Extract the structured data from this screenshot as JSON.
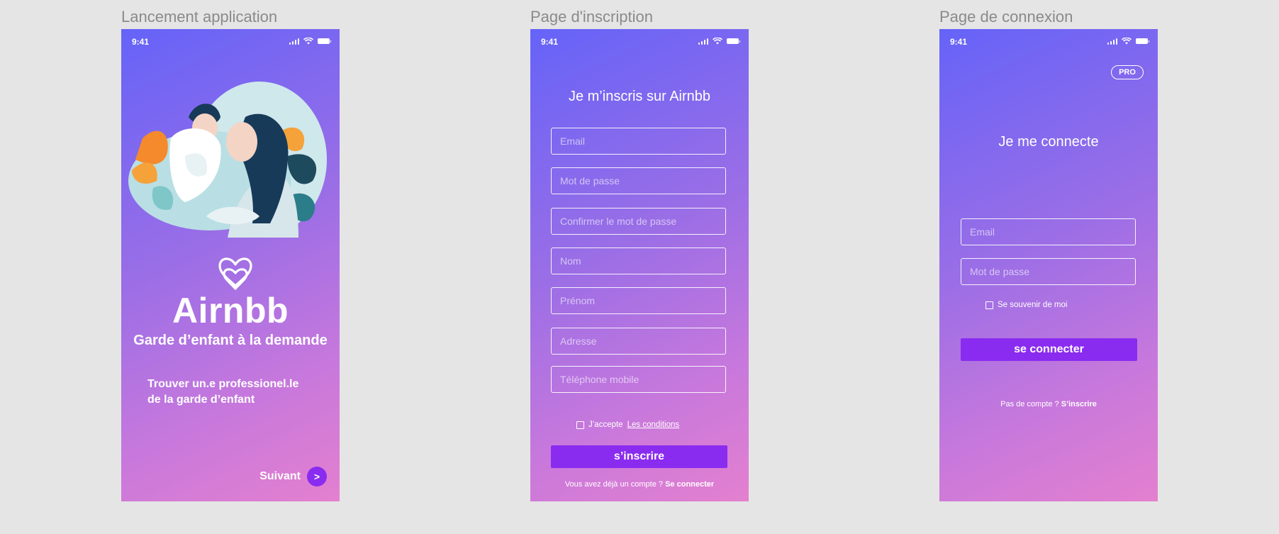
{
  "frames": {
    "launch_title": "Lancement application",
    "signup_title": "Page d'inscription",
    "login_title": "Page de connexion"
  },
  "status_time": "9:41",
  "launch": {
    "brand": "Airnbb",
    "tagline": "Garde d’enfant à la demande",
    "desc_line1": "Trouver un.e professionel.le",
    "desc_line2": "de la garde d’enfant",
    "next_label": "Suivant",
    "next_icon": ">"
  },
  "signup": {
    "title": "Je m’inscris sur Airnbb",
    "fields": {
      "email": "Email",
      "password": "Mot de passe",
      "confirm": "Confirmer le mot de passe",
      "nom": "Nom",
      "prenom": "Prénom",
      "adresse": "Adresse",
      "tel": "Téléphone mobile"
    },
    "accept_text": "J’accepte",
    "conditions_link": "Les conditions",
    "submit": "s’inscrire",
    "have_account": "Vous avez déjà un compte ?",
    "login_link": "Se connecter"
  },
  "login": {
    "pro_badge": "PRO",
    "title": "Je me connecte",
    "fields": {
      "email": "Email",
      "password": "Mot de passe"
    },
    "remember": "Se souvenir de moi",
    "submit": "se connecter",
    "no_account": "Pas de compte ?",
    "signup_link": "S’inscrire"
  },
  "colors": {
    "gradient_start": "#6563f8",
    "gradient_end": "#e480cf",
    "button": "#8a2bf0",
    "canvas": "#e5e5e5"
  },
  "icons": [
    "signal-icon",
    "wifi-icon",
    "battery-icon",
    "heart-logo-icon",
    "chevron-right-icon"
  ]
}
